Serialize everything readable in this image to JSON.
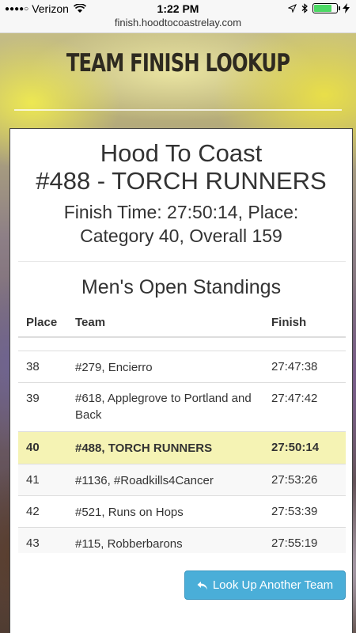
{
  "status_bar": {
    "carrier": "Verizon",
    "time": "1:22 PM",
    "url": "finish.hoodtocoastrelay.com",
    "battery_level": 0.8
  },
  "header": {
    "title": "TEAM FINISH LOOKUP"
  },
  "card": {
    "event": "Hood To Coast",
    "team_heading": "#488 - TORCH RUNNERS",
    "finish_line1": "Finish Time: 27:50:14, Place:",
    "finish_line2": "Category 40, Overall 159",
    "standings_title": "Men's Open Standings"
  },
  "table": {
    "columns": {
      "place": "Place",
      "team": "Team",
      "finish": "Finish"
    },
    "rows": [
      {
        "place": "38",
        "team": "#279, Encierro",
        "finish": "27:47:38"
      },
      {
        "place": "39",
        "team": "#618, Applegrove to Portland and Back",
        "finish": "27:47:42"
      },
      {
        "place": "40",
        "team": "#488, TORCH RUNNERS",
        "finish": "27:50:14",
        "highlight": true
      },
      {
        "place": "41",
        "team": "#1136, #Roadkills4Cancer",
        "finish": "27:53:26"
      },
      {
        "place": "42",
        "team": "#521, Runs on Hops",
        "finish": "27:53:39"
      },
      {
        "place": "43",
        "team": "#115, Robberbarons",
        "finish": "27:55:19"
      }
    ]
  },
  "actions": {
    "lookup_label": "Look Up Another Team"
  },
  "colors": {
    "accent": "#4aaed8",
    "highlight_row": "#f5f3b4",
    "battery": "#4cd964"
  }
}
